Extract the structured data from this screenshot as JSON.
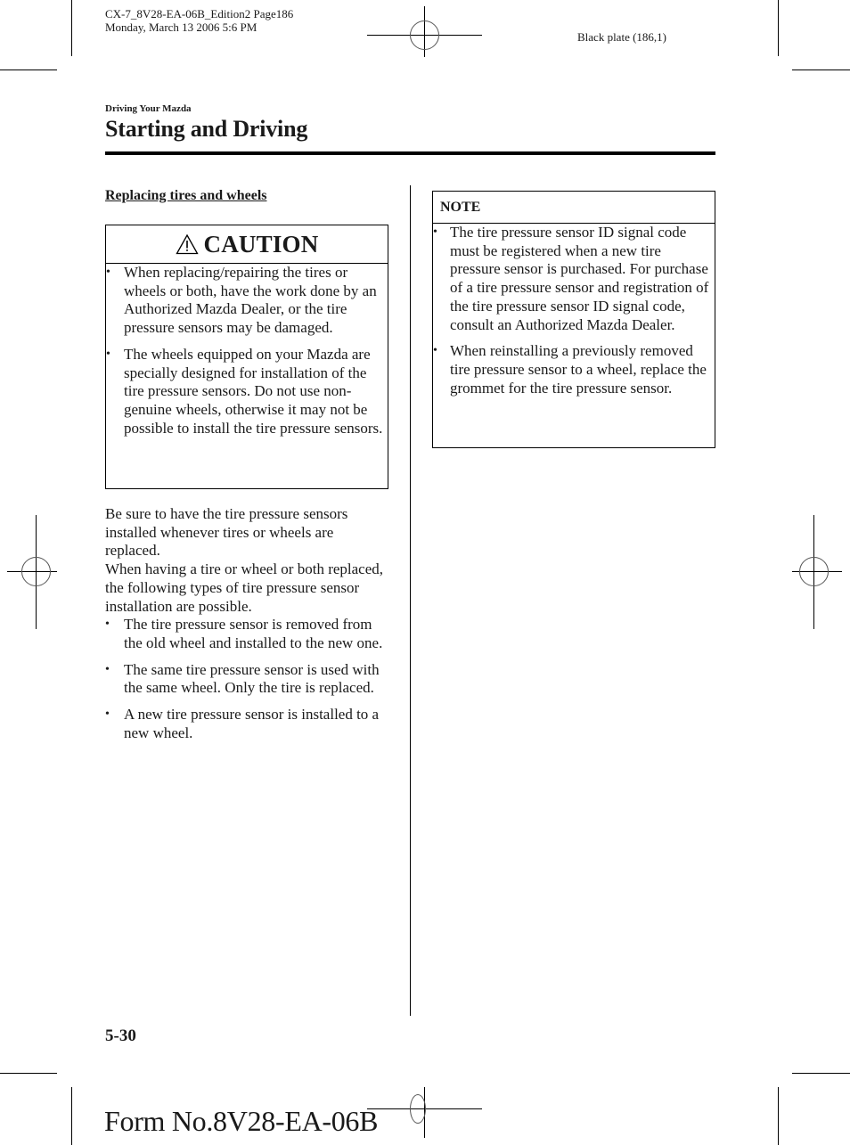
{
  "print_slug": {
    "line1": "CX-7_8V28-EA-06B_Edition2 Page186",
    "line2": "Monday, March 13 2006 5:6 PM",
    "plate": "Black plate (186,1)"
  },
  "header": {
    "section": "Driving Your Mazda",
    "title": "Starting and Driving"
  },
  "left_column": {
    "subheading": "Replacing tires and wheels",
    "caution": {
      "icon": "warning-triangle-icon",
      "title": "CAUTION",
      "items": [
        "When replacing/repairing the tires or wheels or both, have the work done by an Authorized Mazda Dealer, or the tire pressure sensors may be damaged.",
        "The wheels equipped on your Mazda are specially designed for installation of the tire pressure sensors. Do not use non-genuine wheels, otherwise it may not be possible to install the tire pressure sensors."
      ]
    },
    "paragraph1": "Be sure to have the tire pressure sensors installed whenever tires or wheels are replaced.",
    "paragraph2": "When having a tire or wheel or both replaced, the following types of tire pressure sensor installation are possible.",
    "list": [
      "The tire pressure sensor is removed from the old wheel and installed to the new one.",
      "The same tire pressure sensor is used with the same wheel. Only the tire is replaced.",
      "A new tire pressure sensor is installed to a new wheel."
    ]
  },
  "right_column": {
    "note": {
      "title": "NOTE",
      "items": [
        "The tire pressure sensor ID signal code must be registered when a new tire pressure sensor is purchased. For purchase of a tire pressure sensor and registration of the tire pressure sensor ID signal code, consult an Authorized Mazda Dealer.",
        "When reinstalling a previously removed tire pressure sensor to a wheel, replace the grommet for the tire pressure sensor."
      ]
    }
  },
  "footer": {
    "page_number": "5-30",
    "form_number": "Form No.8V28-EA-06B"
  },
  "bullet_glyph": "•"
}
